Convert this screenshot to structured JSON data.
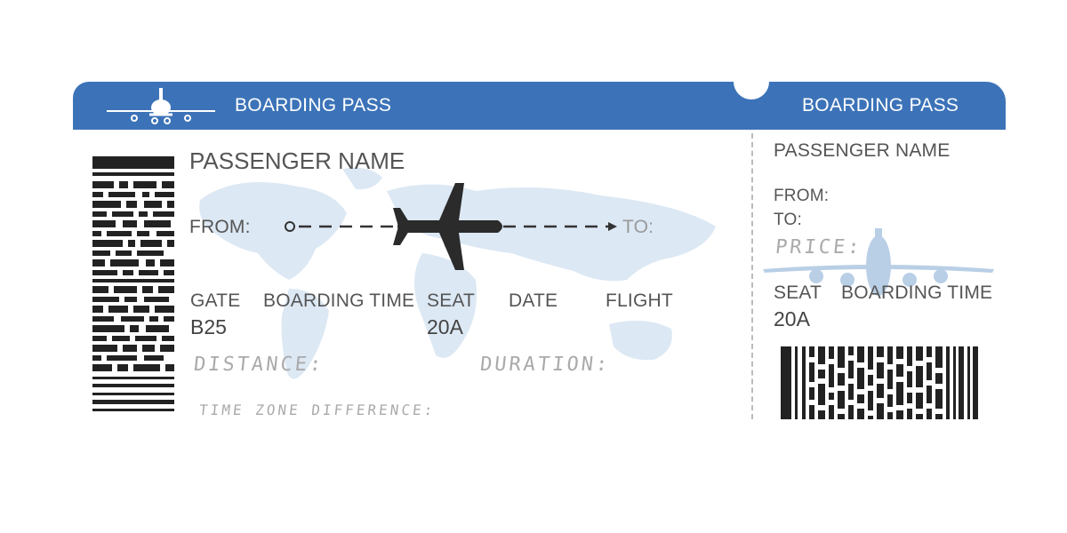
{
  "main": {
    "header_title": "BOARDING PASS",
    "passenger_label": "PASSENGER NAME",
    "from_label": "FROM:",
    "to_label": "TO:",
    "fields": {
      "gate_label": "GATE",
      "gate_value": "B25",
      "boarding_time_label": "BOARDING TIME",
      "seat_label": "SEAT",
      "seat_value": "20A",
      "date_label": "DATE",
      "flight_label": "FLIGHT"
    },
    "handwritten": {
      "distance": "DISTANCE:",
      "duration": "DURATION:",
      "time_zone": "TIME ZONE DIFFERENCE:"
    }
  },
  "stub": {
    "header_title": "BOARDING PASS",
    "passenger_label": "PASSENGER NAME",
    "from_label": "FROM:",
    "to_label": "TO:",
    "price_label": "PRICE:",
    "seat_label": "SEAT",
    "seat_value": "20A",
    "boarding_time_label": "BOARDING TIME"
  },
  "colors": {
    "header_blue": "#3c73b8",
    "map_blue": "#dce8f4",
    "plane_dark": "#2b2b2b"
  },
  "icons": [
    "header-plane-icon",
    "route-plane-icon",
    "stub-plane-watermark-icon",
    "world-map-watermark",
    "vertical-barcode",
    "horizontal-barcode"
  ]
}
